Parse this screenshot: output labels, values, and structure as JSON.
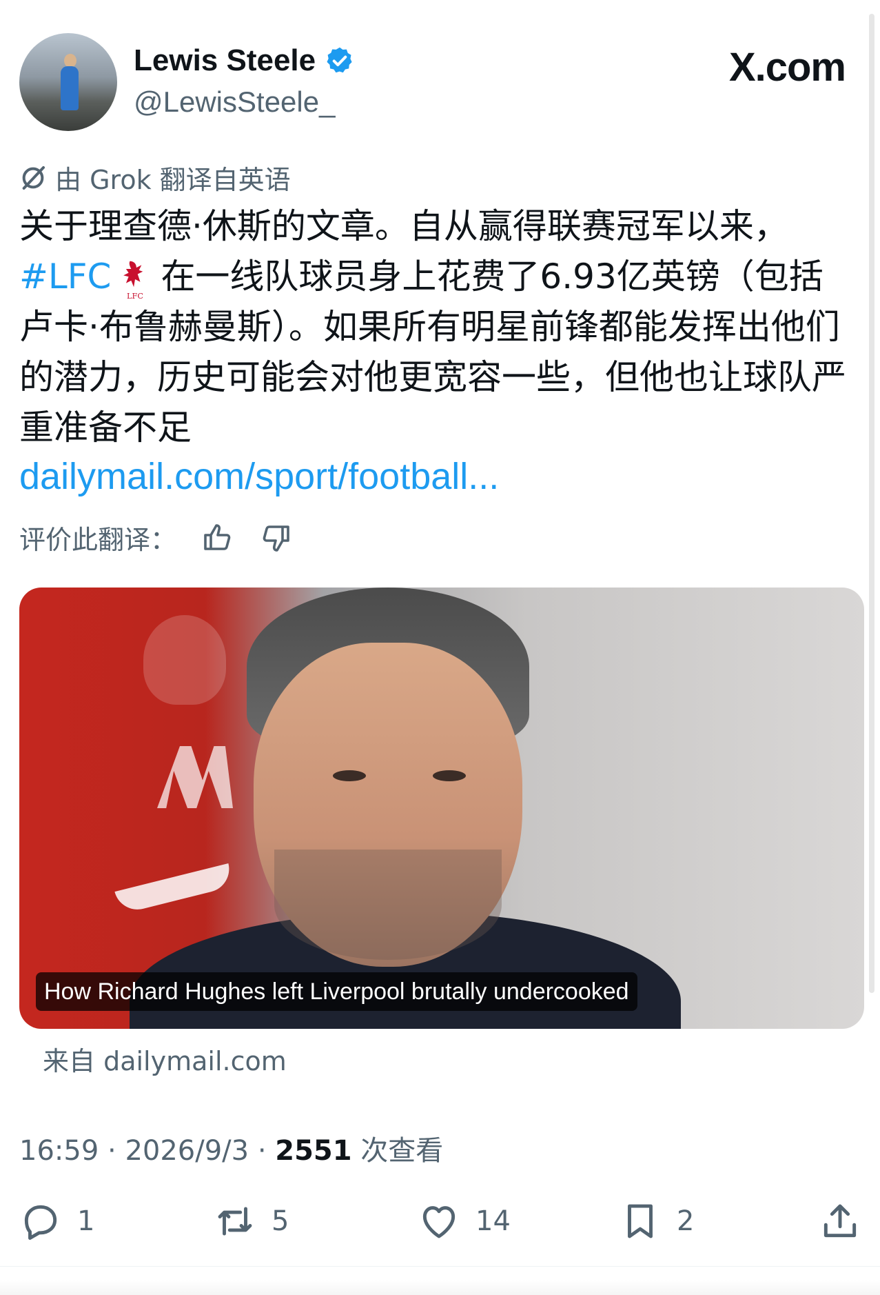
{
  "header": {
    "display_name": "Lewis Steele",
    "handle": "@LewisSteele_",
    "brand": "X.com"
  },
  "translation": {
    "note": "由 Grok 翻译自英语",
    "rate_label": "评价此翻译："
  },
  "tweet": {
    "text_line1": "关于理查德·休斯的文章。自从赢得联赛冠军以来，",
    "hashtag": "#LFC",
    "text_rest": "在一线队球员身上花费了6.93亿英镑（包括卢卡·布鲁赫曼斯）。如果所有明星前锋都能发挥出他们的潜力，历史可能会对他更宽容一些，但他也让球队严重准备不足",
    "link": "dailymail.com/sport/football..."
  },
  "card": {
    "caption": "How Richard Hughes left Liverpool brutally undercooked",
    "source": "来自 dailymail.com"
  },
  "meta": {
    "time": "16:59",
    "sep": "·",
    "date": "2026/9/3",
    "views_count": "2551",
    "views_label": "次查看"
  },
  "actions": {
    "reply_count": "1",
    "retweet_count": "5",
    "like_count": "14",
    "bookmark_count": "2"
  },
  "colors": {
    "accent": "#1d9bf0",
    "text": "#0f1419",
    "muted": "#536471"
  }
}
